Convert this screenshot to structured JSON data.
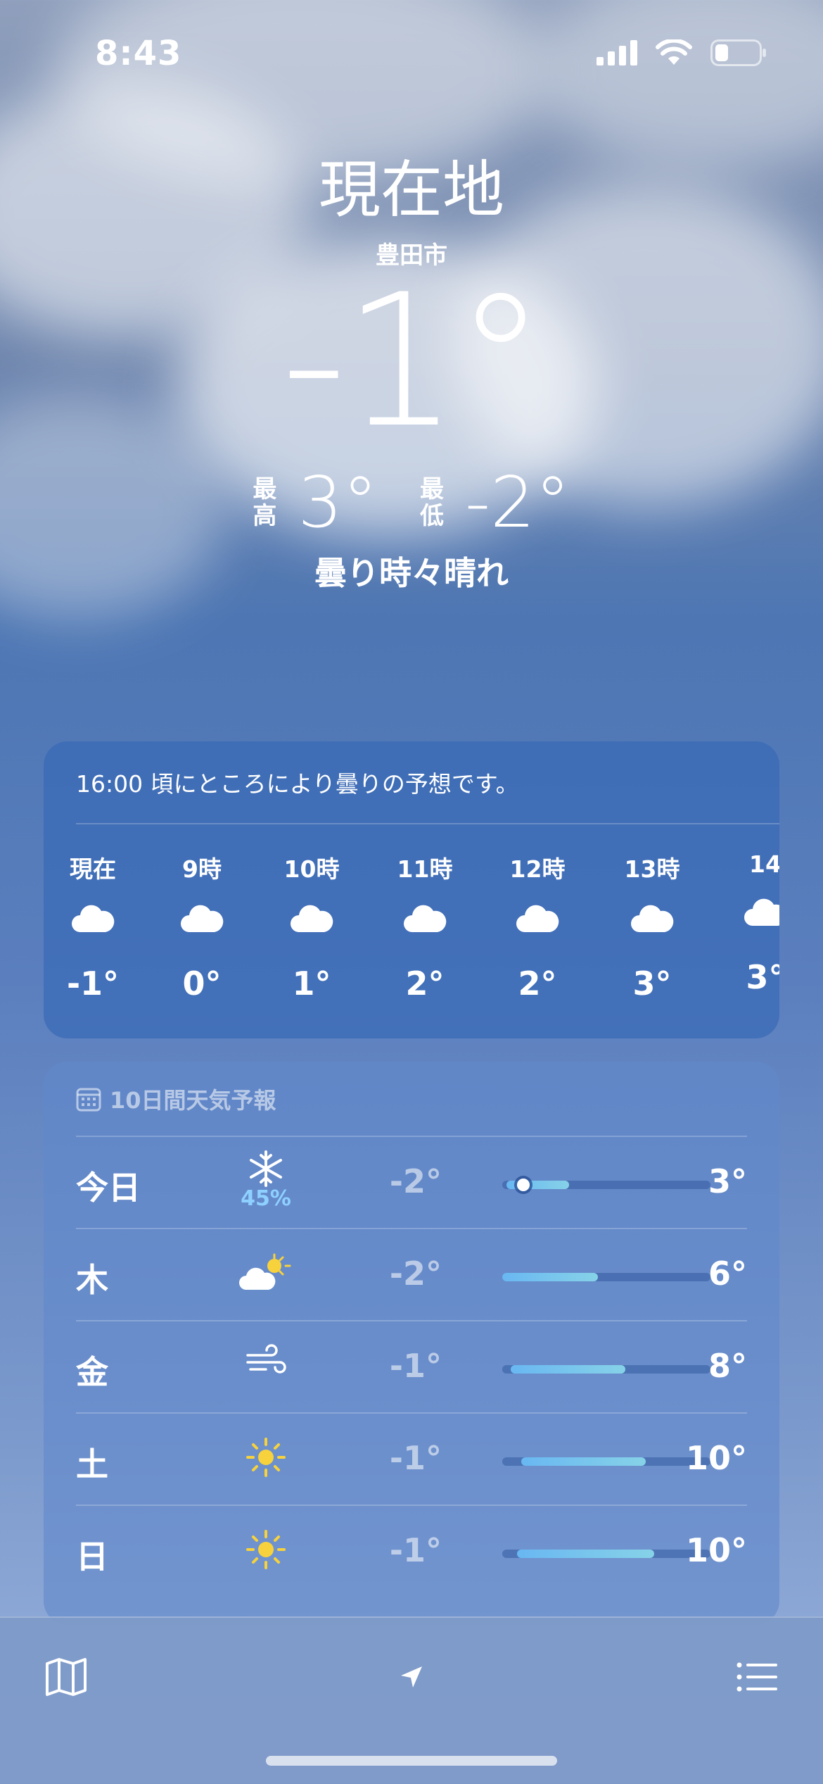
{
  "status": {
    "time": "8:43"
  },
  "header": {
    "location": "現在地",
    "sublocation": "豊田市",
    "temperature": "-1°",
    "high_label": [
      "最",
      "高"
    ],
    "high": "3°",
    "low_label": [
      "最",
      "低"
    ],
    "low": "-2°",
    "condition": "曇り時々晴れ"
  },
  "hourly": {
    "summary": "16:00 頃にところにより曇りの予想です。",
    "items": [
      {
        "label": "現在",
        "icon": "cloud-icon",
        "temp": "-1°"
      },
      {
        "label": "9時",
        "icon": "cloud-icon",
        "temp": "0°"
      },
      {
        "label": "10時",
        "icon": "cloud-icon",
        "temp": "1°"
      },
      {
        "label": "11時",
        "icon": "cloud-icon",
        "temp": "2°"
      },
      {
        "label": "12時",
        "icon": "cloud-icon",
        "temp": "2°"
      },
      {
        "label": "13時",
        "icon": "cloud-icon",
        "temp": "3°"
      },
      {
        "label": "14",
        "icon": "cloud-icon",
        "temp": "3°"
      }
    ]
  },
  "daily": {
    "title": "10日間天気予報",
    "icon": "calendar-icon",
    "days": [
      {
        "name": "今日",
        "icon": "snowflake-icon",
        "precip": "45%",
        "low": "-2°",
        "high": "3°",
        "range_start": 0.02,
        "range_end": 0.32,
        "current": 0.1
      },
      {
        "name": "木",
        "icon": "partly-sunny-icon",
        "precip": "",
        "low": "-2°",
        "high": "6°",
        "range_start": 0.0,
        "range_end": 0.46
      },
      {
        "name": "金",
        "icon": "wind-icon",
        "precip": "",
        "low": "-1°",
        "high": "8°",
        "range_start": 0.04,
        "range_end": 0.59
      },
      {
        "name": "土",
        "icon": "sun-icon",
        "precip": "",
        "low": "-1°",
        "high": "10°",
        "range_start": 0.09,
        "range_end": 0.69
      },
      {
        "name": "日",
        "icon": "sun-icon",
        "precip": "",
        "low": "-1°",
        "high": "10°",
        "range_start": 0.07,
        "range_end": 0.73
      }
    ]
  },
  "toolbar": {
    "map_icon": "map-icon",
    "location_icon": "location-arrow-icon",
    "list_icon": "list-icon"
  },
  "colors": {
    "accent_blue": "#69b7f2",
    "precip_blue": "#8ed0ff",
    "sun_yellow": "#f7d23c"
  }
}
